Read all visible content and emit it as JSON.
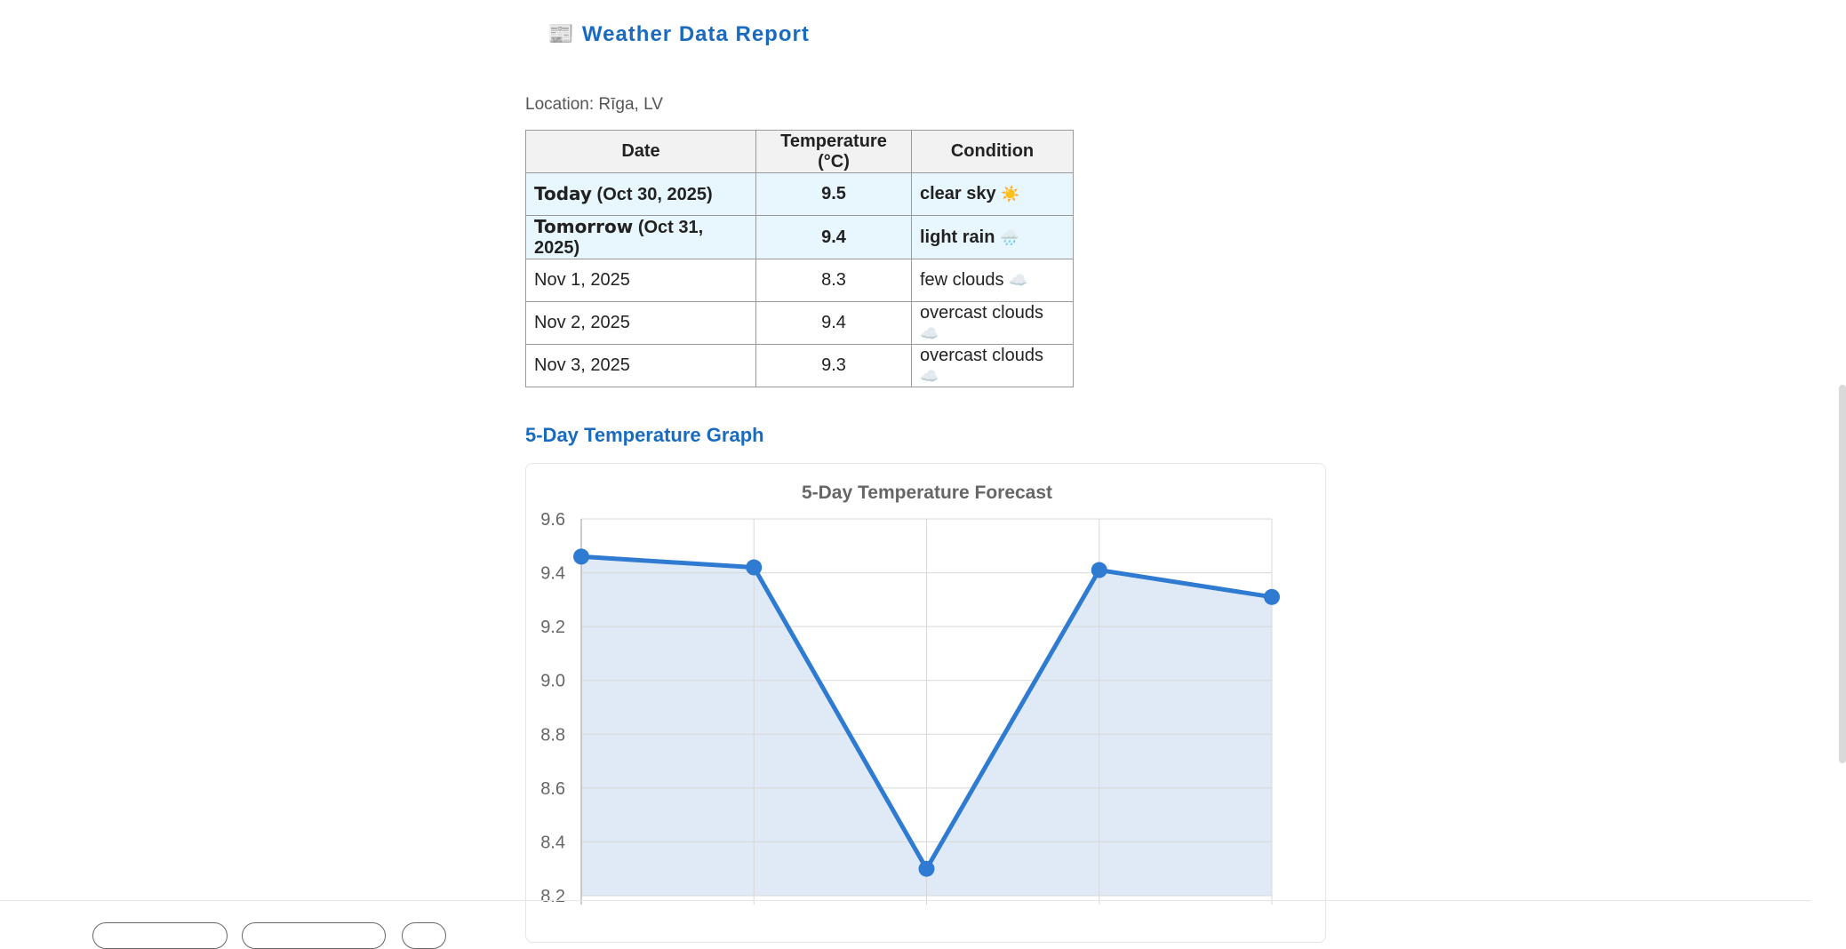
{
  "report": {
    "icon": "newspaper-icon",
    "icon_glyph": "📰",
    "title": "Weather Data Report",
    "location": "Location: Rīga, LV"
  },
  "table": {
    "headers": [
      "Date",
      "Temperature (°C)",
      "Condition"
    ],
    "rows": [
      {
        "day": "Today",
        "date": "(Oct 30, 2025)",
        "temp": "9.5",
        "condition": "clear sky",
        "icon": "☀️",
        "icon_name": "sun-icon",
        "highlight": true
      },
      {
        "day": "Tomorrow",
        "date": "(Oct 31, 2025)",
        "temp": "9.4",
        "condition": "light rain",
        "icon": "🌧️",
        "icon_name": "rain-cloud-icon",
        "highlight": true
      },
      {
        "day": "",
        "date": "Nov 1, 2025",
        "temp": "8.3",
        "condition": "few clouds",
        "icon": "☁️",
        "icon_name": "cloud-icon",
        "highlight": false
      },
      {
        "day": "",
        "date": "Nov 2, 2025",
        "temp": "9.4",
        "condition": "overcast clouds",
        "icon": "☁️",
        "icon_name": "cloud-icon",
        "highlight": false
      },
      {
        "day": "",
        "date": "Nov 3, 2025",
        "temp": "9.3",
        "condition": "overcast clouds",
        "icon": "☁️",
        "icon_name": "cloud-icon",
        "highlight": false
      }
    ]
  },
  "graph_heading": "5-Day Temperature Graph",
  "chart_data": {
    "type": "line",
    "title": "5-Day Temperature Forecast",
    "x": [
      0,
      1,
      2,
      3,
      4
    ],
    "values": [
      9.46,
      9.42,
      8.3,
      9.41,
      9.31
    ],
    "ylim": [
      8.2,
      9.6
    ],
    "yticks": [
      "9.6",
      "9.4",
      "9.2",
      "9.0",
      "8.8",
      "8.6",
      "8.4",
      "8.2"
    ],
    "xlabel": "",
    "ylabel": "",
    "fill": true,
    "grid": true,
    "line_color": "#2f7bd1",
    "fill_color": "#dfeaf6"
  }
}
